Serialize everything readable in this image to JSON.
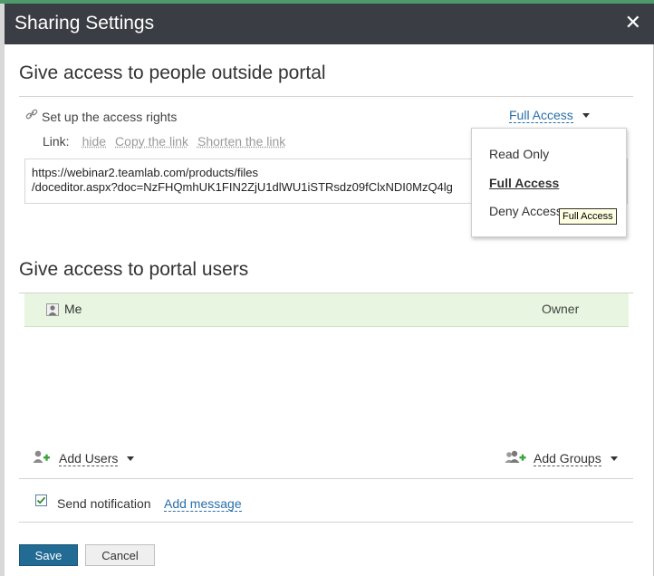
{
  "dialog": {
    "title": "Sharing Settings",
    "close_glyph": "✕"
  },
  "outside": {
    "heading": "Give access to people outside portal",
    "access_label": "Set up the access rights",
    "access_value": "Full Access",
    "link_label": "Link:",
    "hide_label": "hide",
    "copy_label": "Copy the link",
    "shorten_label": "Shorten the link",
    "url_line1": "https://webinar2.teamlab.com/products/files",
    "url_line2": "/doceditor.aspx?doc=NzFHQmhUK1FIN2ZjU1dlWU1iSTRsdz09fClxNDI0MzQ4lg"
  },
  "access_menu": {
    "items": [
      "Read Only",
      "Full Access",
      "Deny Access"
    ],
    "selected": "Full Access",
    "tooltip": "Full Access"
  },
  "portal": {
    "heading": "Give access to portal users",
    "owner_name": "Me",
    "owner_role": "Owner",
    "add_users_label": "Add Users",
    "add_groups_label": "Add Groups"
  },
  "notify": {
    "send_label": "Send notification",
    "add_message_label": "Add message",
    "checked": true
  },
  "buttons": {
    "save": "Save",
    "cancel": "Cancel"
  },
  "colors": {
    "titlebar": "#3a3d43",
    "accent_link": "#2a6ea7",
    "save_button": "#216b95",
    "owner_row": "#e8f6e1",
    "add_icon_green": "#3aa53a"
  },
  "icons": {
    "access": "link-icon",
    "owner": "user-avatar-icon",
    "add_users": "add-user-icon",
    "add_groups": "add-group-icon",
    "notify": "checkbox-checked-icon"
  }
}
